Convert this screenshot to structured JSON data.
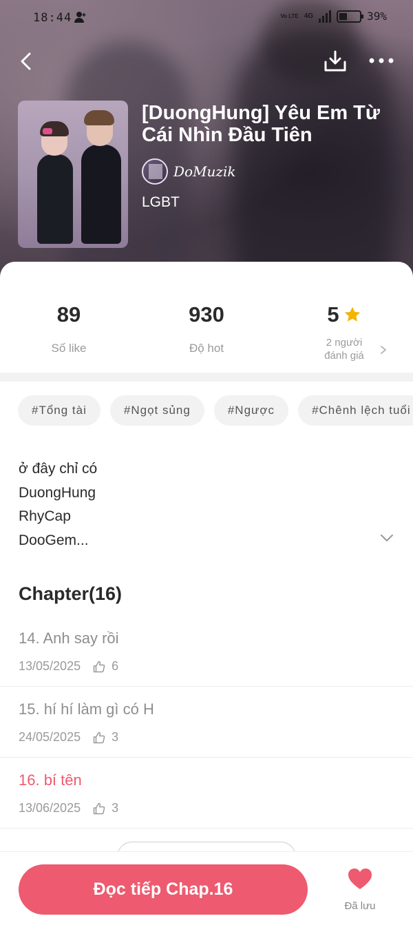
{
  "status_bar": {
    "time": "18:44",
    "network": "4G",
    "volte": "Vo LTE",
    "battery_percent": "39%",
    "battery_level": 0.39
  },
  "story": {
    "title": "[DuongHung] Yêu Em Từ Cái Nhìn Đầu Tiên",
    "author": "DoMuzik",
    "genre": "LGBT"
  },
  "stats": {
    "likes": {
      "value": "89",
      "label": "Số like"
    },
    "hot": {
      "value": "930",
      "label": "Độ hot"
    },
    "rating": {
      "value": "5",
      "label_line1": "2 người",
      "label_line2": "đánh giá"
    }
  },
  "tags": [
    "#Tổng tài",
    "#Ngọt sủng",
    "#Ngược",
    "#Chênh lệch tuổi"
  ],
  "description": [
    "ở đây chỉ có",
    "DuongHung",
    "RhyCap",
    "DooGem..."
  ],
  "chapters": {
    "heading": "Chapter(16)",
    "items": [
      {
        "title": "14. Anh say rồi",
        "date": "13/05/2025",
        "likes": "6"
      },
      {
        "title": "15. hí hí làm gì có H",
        "date": "24/05/2025",
        "likes": "3"
      },
      {
        "title": "16. bí tên",
        "date": "13/06/2025",
        "likes": "3"
      }
    ]
  },
  "bottom": {
    "read_label": "Đọc tiếp Chap.16",
    "saved_label": "Đã lưu"
  },
  "colors": {
    "accent": "#ee5a6f",
    "star": "#f5b400",
    "muted": "#9a9a9a"
  },
  "icons": [
    "back-icon",
    "download-icon",
    "more-icon",
    "star-icon",
    "chevron-right-icon",
    "chevron-down-icon",
    "like-icon",
    "heart-icon"
  ]
}
